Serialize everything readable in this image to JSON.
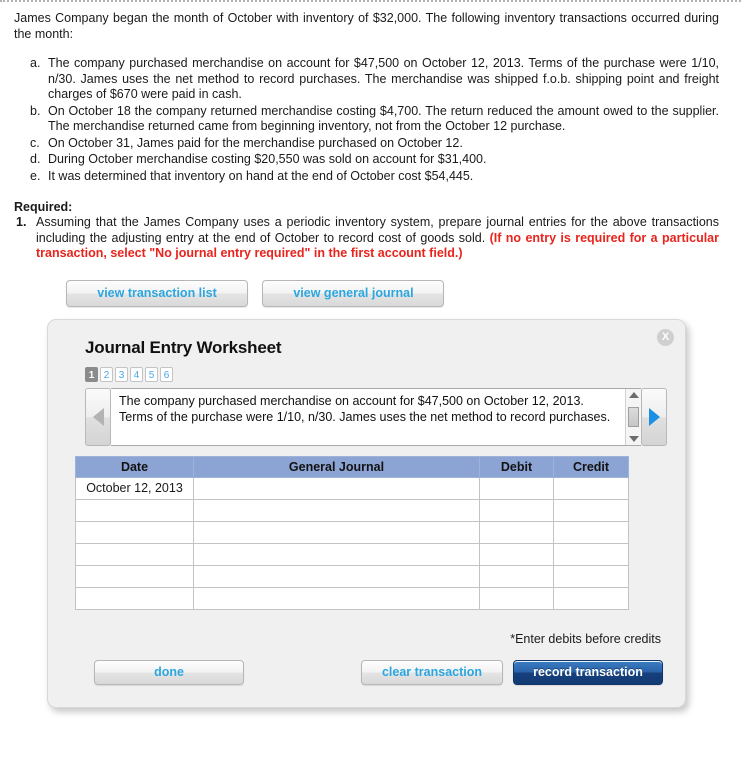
{
  "problem": {
    "intro": "James Company began the month of October with inventory of $32,000. The following inventory transactions occurred during the month:",
    "items": [
      {
        "marker": "a.",
        "text": "The company purchased merchandise on account for $47,500 on October 12, 2013. Terms of the purchase were 1/10, n/30. James uses the net method to record purchases. The merchandise was shipped f.o.b. shipping point and freight charges of $670 were paid in cash."
      },
      {
        "marker": "b.",
        "text": "On October 18 the company returned merchandise costing $4,700. The return reduced the amount owed to the supplier. The merchandise returned came from beginning inventory, not from the October 12 purchase."
      },
      {
        "marker": "c.",
        "text": "On October 31, James paid for the merchandise purchased on October 12."
      },
      {
        "marker": "d.",
        "text": "During October merchandise costing $20,550 was sold on account for $31,400."
      },
      {
        "marker": "e.",
        "text": "It was determined that inventory on hand at the end of October cost $54,445."
      }
    ],
    "required_heading": "Required:",
    "required_number": "1.",
    "required_text": "Assuming that the James Company uses a periodic inventory system, prepare journal entries for the above transactions including the adjusting entry at the end of October to record cost of goods sold. ",
    "required_note": "(If no entry is required for a particular transaction, select \"No journal entry required\" in the first account field.)"
  },
  "view_buttons": {
    "transaction_list": "view transaction list",
    "general_journal": "view general journal"
  },
  "worksheet": {
    "title": "Journal Entry Worksheet",
    "close_label": "X",
    "tabs": [
      {
        "label": "1",
        "active": true
      },
      {
        "label": "2",
        "active": false
      },
      {
        "label": "3",
        "active": false
      },
      {
        "label": "4",
        "active": false
      },
      {
        "label": "5",
        "active": false
      },
      {
        "label": "6",
        "active": false
      }
    ],
    "description": "The company purchased merchandise on account for $47,500 on October 12, 2013. Terms of the purchase were 1/10, n/30. James uses the net method to record purchases.",
    "prev_icon": "triangle-left-icon",
    "next_icon": "triangle-right-icon",
    "table": {
      "headers": [
        "Date",
        "General Journal",
        "Debit",
        "Credit"
      ],
      "rows": [
        {
          "date": "October 12, 2013",
          "journal": "",
          "debit": "",
          "credit": ""
        },
        {
          "date": "",
          "journal": "",
          "debit": "",
          "credit": ""
        },
        {
          "date": "",
          "journal": "",
          "debit": "",
          "credit": ""
        },
        {
          "date": "",
          "journal": "",
          "debit": "",
          "credit": ""
        },
        {
          "date": "",
          "journal": "",
          "debit": "",
          "credit": ""
        },
        {
          "date": "",
          "journal": "",
          "debit": "",
          "credit": ""
        }
      ]
    },
    "footnote": "*Enter debits before credits",
    "buttons": {
      "done": "done",
      "clear": "clear transaction",
      "record": "record transaction"
    }
  },
  "colors": {
    "accent_blue": "#2ba6e0",
    "primary_blue": "#16407d",
    "table_header_blue": "#8ca4d4",
    "input_border_yellow": "#f2f21f",
    "alert_red": "#e8241c"
  }
}
